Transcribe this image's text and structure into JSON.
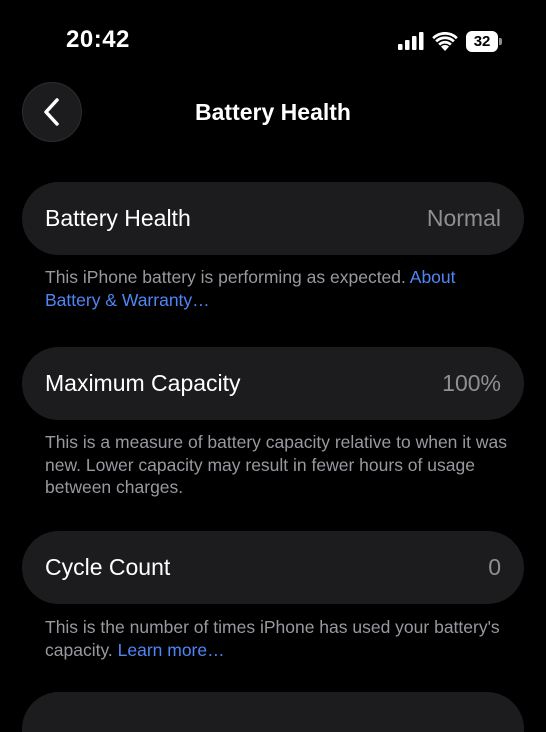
{
  "status_bar": {
    "time": "20:42",
    "battery_level": "32",
    "signal_icon": "cellular-signal-icon",
    "wifi_icon": "wifi-icon"
  },
  "nav": {
    "back_icon": "chevron-left-icon",
    "title": "Battery Health"
  },
  "sections": [
    {
      "label": "Battery Health",
      "value": "Normal",
      "description": "This iPhone battery is performing as expected. ",
      "link": "About Battery & Warranty…"
    },
    {
      "label": "Maximum Capacity",
      "value": "100%",
      "description": "This is a measure of battery capacity relative to when it was new. Lower capacity may result in fewer hours of usage between charges.",
      "link": ""
    },
    {
      "label": "Cycle Count",
      "value": "0",
      "description": "This is the number of times iPhone has used your battery's capacity. ",
      "link": "Learn more…"
    }
  ],
  "colors": {
    "background": "#000000",
    "card": "#1c1c1e",
    "secondary_text": "#98989f",
    "link": "#4f86f7"
  }
}
